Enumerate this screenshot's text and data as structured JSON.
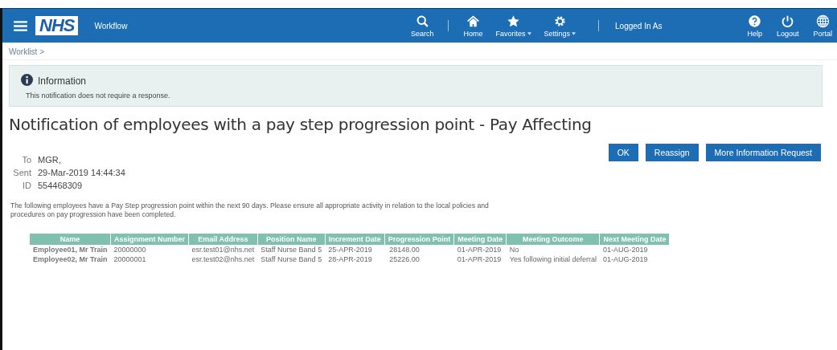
{
  "header": {
    "logo": "NHS",
    "app_name": "Workflow",
    "nav": [
      {
        "label": "Search",
        "kind": "search",
        "dropdown": false
      },
      {
        "label": "Home",
        "kind": "home",
        "dropdown": false
      },
      {
        "label": "Favorites",
        "kind": "star",
        "dropdown": true
      },
      {
        "label": "Settings",
        "kind": "gear",
        "dropdown": true
      }
    ],
    "user_label": "Logged In As",
    "actions": [
      {
        "label": "Help",
        "kind": "help"
      },
      {
        "label": "Logout",
        "kind": "power"
      },
      {
        "label": "Portal",
        "kind": "globe"
      }
    ]
  },
  "breadcrumb": "Worklist >",
  "info": {
    "title": "Information",
    "message": "This notification does not require a response."
  },
  "title": "Notification of employees with a pay step progression point - Pay Affecting",
  "buttons": [
    "OK",
    "Reassign",
    "More Information Request"
  ],
  "details": [
    {
      "label": "To",
      "value": "MGR,"
    },
    {
      "label": "Sent",
      "value": "29-Mar-2019 14:44:34"
    },
    {
      "label": "ID",
      "value": "554468309"
    }
  ],
  "message": "The following employees have a Pay Step progression point within the next 90 days. Please ensure all appropriate activity in relation to the local policies and procedures on pay progression have been completed.",
  "table": {
    "columns": [
      "Name",
      "Assignment Number",
      "Email Address",
      "Position Name",
      "Increment Date",
      "Progression Point",
      "Meeting Date",
      "Meeting Outcome",
      "Next Meeting Date"
    ],
    "rows": [
      [
        "Employee01, Mr Train",
        "20000000",
        "esr.test01@nhs.net",
        "Staff Nurse Band 5",
        "25-APR-2019",
        "28148.00",
        "01-APR-2019",
        "No",
        "01-AUG-2019"
      ],
      [
        "Employee02, Mr Train",
        "20000001",
        "esr.test02@nhs.net",
        "Staff Nurse Band 5",
        "28-APR-2019",
        "25226.00",
        "01-APR-2019",
        "Yes following initial deferral",
        "01-AUG-2019"
      ]
    ]
  }
}
